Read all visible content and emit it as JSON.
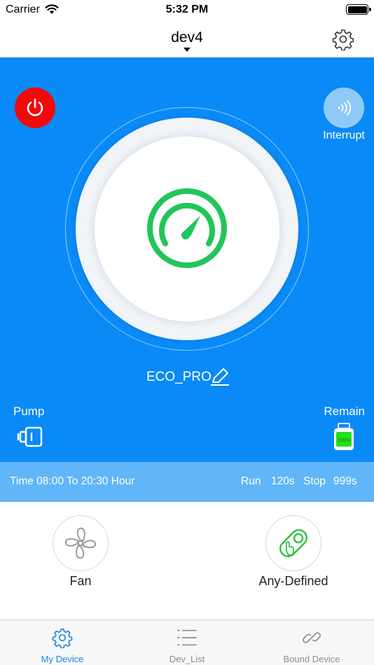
{
  "status_bar": {
    "carrier": "Carrier",
    "time": "5:32 PM"
  },
  "nav": {
    "title": "dev4",
    "icons": {
      "settings": "gear-icon",
      "dropdown": "caret-down-icon"
    }
  },
  "controls": {
    "interrupt_label": "Interrupt",
    "mode_name": "ECO_PRO",
    "pump_label": "Pump",
    "remain_label": "Remain",
    "remain_level": "100%",
    "remain_fraction": 1.0
  },
  "schedule": {
    "time_text": "Time 08:00 To 20:30 Hour",
    "run_label": "Run",
    "run_value": "120s",
    "stop_label": "Stop",
    "stop_value": "999s"
  },
  "actions": {
    "fan_label": "Fan",
    "custom_label": "Any-Defined"
  },
  "tabs": [
    {
      "label": "My Device",
      "icon": "gear-icon",
      "active": true
    },
    {
      "label": "Dev_List",
      "icon": "list-icon",
      "active": false
    },
    {
      "label": "Bound Device",
      "icon": "link-icon",
      "active": false
    }
  ],
  "colors": {
    "primary": "#0a8af6",
    "power": "#f10a0a",
    "gauge": "#22c55a",
    "time_bar": "#60b6f8",
    "tab_active": "#1f86e4",
    "tab_inactive": "#8e8e93"
  }
}
